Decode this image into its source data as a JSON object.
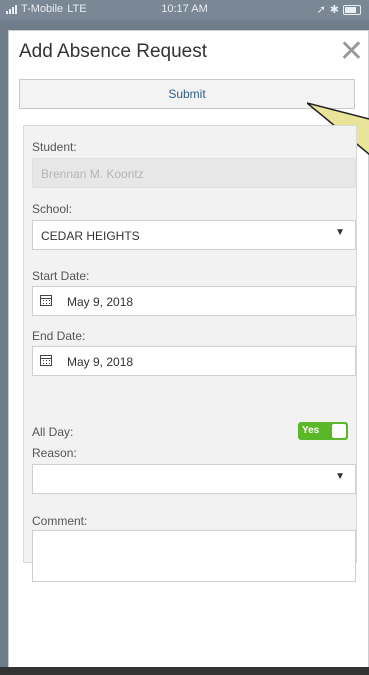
{
  "status_bar": {
    "carrier": "T-Mobile",
    "network": "LTE",
    "time": "10:17 AM"
  },
  "modal": {
    "title": "Add Absence Request",
    "close_icon": "close-icon",
    "submit_label": "Submit"
  },
  "form": {
    "student": {
      "label": "Student:",
      "value": "Brennan M. Koontz"
    },
    "school": {
      "label": "School:",
      "value": "CEDAR HEIGHTS"
    },
    "start_date": {
      "label": "Start Date:",
      "value": "May 9, 2018",
      "icon": "calendar-icon"
    },
    "end_date": {
      "label": "End Date:",
      "value": "May 9, 2018",
      "icon": "calendar-icon"
    },
    "all_day": {
      "label": "All Day:",
      "toggle_label": "Yes",
      "toggle_color": "#5ab728"
    },
    "reason": {
      "label": "Reason:",
      "value": ""
    },
    "comment": {
      "label": "Comment:",
      "value": ""
    }
  }
}
